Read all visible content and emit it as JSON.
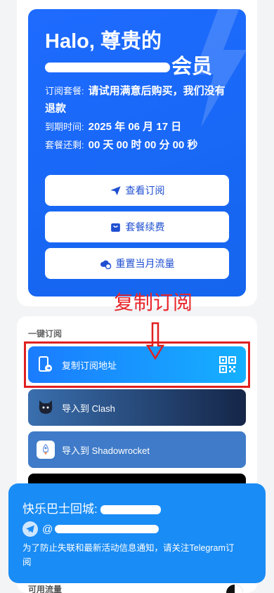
{
  "hero": {
    "greeting_line1": "Halo, 尊贵的",
    "greeting_suffix": "会员",
    "plan_label": "订阅套餐:",
    "plan_value": "请试用满意后购买，我们没有退款",
    "expire_label": "到期时间:",
    "expire_value": "2025 年 06 月 17 日",
    "remain_label": "套餐还剩:",
    "remain_value": "00 天 00 时 00 分 00 秒",
    "buttons": [
      {
        "label": "查看订阅",
        "icon": "paper-plane-icon"
      },
      {
        "label": "套餐续费",
        "icon": "shopping-bag-icon"
      },
      {
        "label": "重置当月流量",
        "icon": "cloud-refresh-icon"
      }
    ],
    "bg_color": "#1E6BFF"
  },
  "annotation": {
    "label": "复制订阅",
    "color": "#E8262B"
  },
  "subscribe": {
    "title": "一键订阅",
    "items": [
      {
        "label": "复制订阅地址",
        "icon": "phone-copy-icon",
        "color": "#1E9BFF"
      },
      {
        "label": "导入到 Clash",
        "icon": "clash-cat-icon",
        "color": "#24406E"
      },
      {
        "label": "导入到 Shadowrocket",
        "icon": "rocket-icon",
        "color": "#3F7BC8"
      }
    ]
  },
  "notice": {
    "title": "快乐巴士回城:",
    "telegram_prefix": "@",
    "description": "为了防止失联和最新活动信息通知，请关注Telegram订阅",
    "bg_color": "#1A8CF5"
  },
  "footer": {
    "label": "可用流量"
  }
}
